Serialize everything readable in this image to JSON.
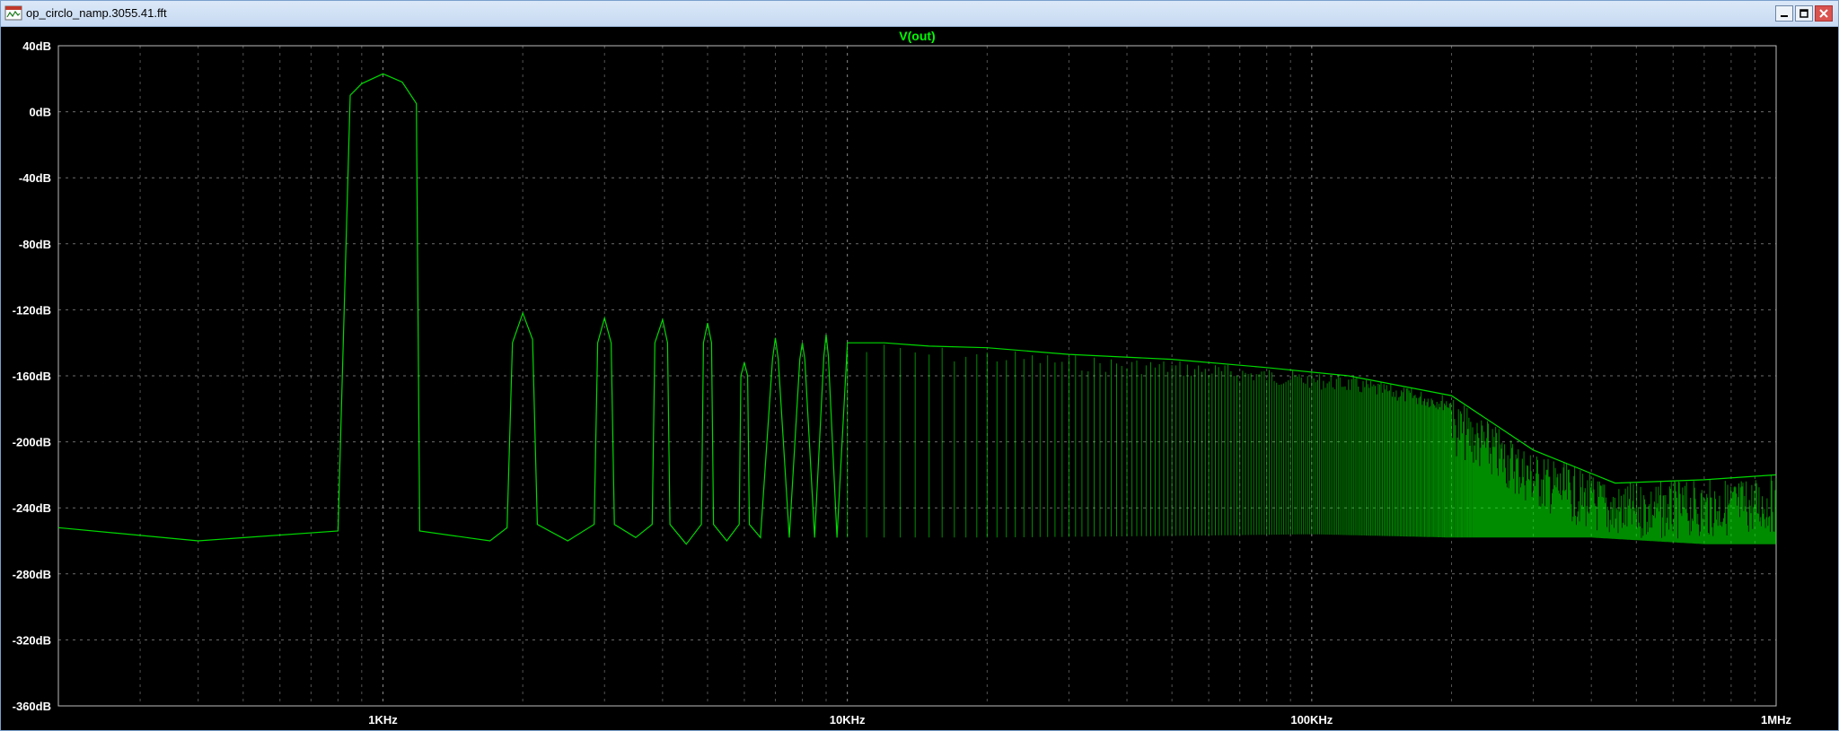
{
  "window": {
    "title": "op_circlo_namp.3055.41.fft",
    "minimize_icon": "minimize-icon",
    "maximize_icon": "maximize-icon",
    "close_icon": "close-icon",
    "app_icon": "waveform-document-icon"
  },
  "colors": {
    "background": "#000000",
    "trace": "#00ff00",
    "grid": "#9a9a9a",
    "axis_text": "#ffffff",
    "trace_label": "#00ff00"
  },
  "chart_data": {
    "type": "line",
    "title": "V(out)",
    "xscale": "log",
    "xlim": [
      200,
      1000000
    ],
    "ylim": [
      -360,
      40
    ],
    "x_ticks": [
      1000,
      10000,
      100000,
      1000000
    ],
    "x_tick_labels": [
      "1KHz",
      "10KHz",
      "100KHz",
      "1MHz"
    ],
    "y_ticks": [
      40,
      0,
      -40,
      -80,
      -120,
      -160,
      -200,
      -240,
      -280,
      -320,
      -360
    ],
    "y_tick_labels": [
      "40dB",
      "0dB",
      "-40dB",
      "-80dB",
      "-120dB",
      "-160dB",
      "-200dB",
      "-240dB",
      "-280dB",
      "-320dB",
      "-360dB"
    ],
    "grid": true,
    "series": [
      {
        "name": "V(out)",
        "points": [
          [
            200,
            -252
          ],
          [
            400,
            -260
          ],
          [
            800,
            -254
          ],
          [
            850,
            10
          ],
          [
            900,
            17
          ],
          [
            1000,
            23
          ],
          [
            1100,
            18
          ],
          [
            1180,
            5
          ],
          [
            1200,
            -254
          ],
          [
            1700,
            -260
          ],
          [
            1850,
            -252
          ],
          [
            1900,
            -140
          ],
          [
            2000,
            -122
          ],
          [
            2100,
            -138
          ],
          [
            2150,
            -250
          ],
          [
            2500,
            -260
          ],
          [
            2850,
            -250
          ],
          [
            2900,
            -140
          ],
          [
            3000,
            -125
          ],
          [
            3100,
            -140
          ],
          [
            3150,
            -250
          ],
          [
            3500,
            -258
          ],
          [
            3800,
            -250
          ],
          [
            3850,
            -140
          ],
          [
            4000,
            -126
          ],
          [
            4100,
            -140
          ],
          [
            4150,
            -250
          ],
          [
            4500,
            -262
          ],
          [
            4850,
            -250
          ],
          [
            4900,
            -140
          ],
          [
            5000,
            -128
          ],
          [
            5100,
            -140
          ],
          [
            5150,
            -250
          ],
          [
            5500,
            -260
          ],
          [
            5850,
            -250
          ],
          [
            5900,
            -160
          ],
          [
            6000,
            -152
          ],
          [
            6100,
            -160
          ],
          [
            6150,
            -250
          ],
          [
            6500,
            -258
          ],
          [
            6900,
            -150
          ],
          [
            7000,
            -137
          ],
          [
            7100,
            -150
          ],
          [
            7500,
            -258
          ],
          [
            7900,
            -150
          ],
          [
            8000,
            -140
          ],
          [
            8100,
            -150
          ],
          [
            8500,
            -258
          ],
          [
            8900,
            -148
          ],
          [
            9000,
            -135
          ],
          [
            9100,
            -148
          ],
          [
            9500,
            -258
          ],
          [
            10000,
            -140
          ],
          [
            12000,
            -140
          ],
          [
            15000,
            -142
          ],
          [
            20000,
            -143
          ],
          [
            30000,
            -147
          ],
          [
            50000,
            -150
          ],
          [
            80000,
            -155
          ],
          [
            120000,
            -160
          ],
          [
            200000,
            -172
          ],
          [
            300000,
            -205
          ],
          [
            450000,
            -225
          ],
          [
            700000,
            -223
          ],
          [
            1000000,
            -220
          ]
        ],
        "floor": [
          [
            10000,
            -258
          ],
          [
            20000,
            -258
          ],
          [
            50000,
            -257
          ],
          [
            100000,
            -256
          ],
          [
            200000,
            -258
          ],
          [
            400000,
            -258
          ],
          [
            700000,
            -262
          ],
          [
            1000000,
            -262
          ]
        ]
      }
    ]
  }
}
